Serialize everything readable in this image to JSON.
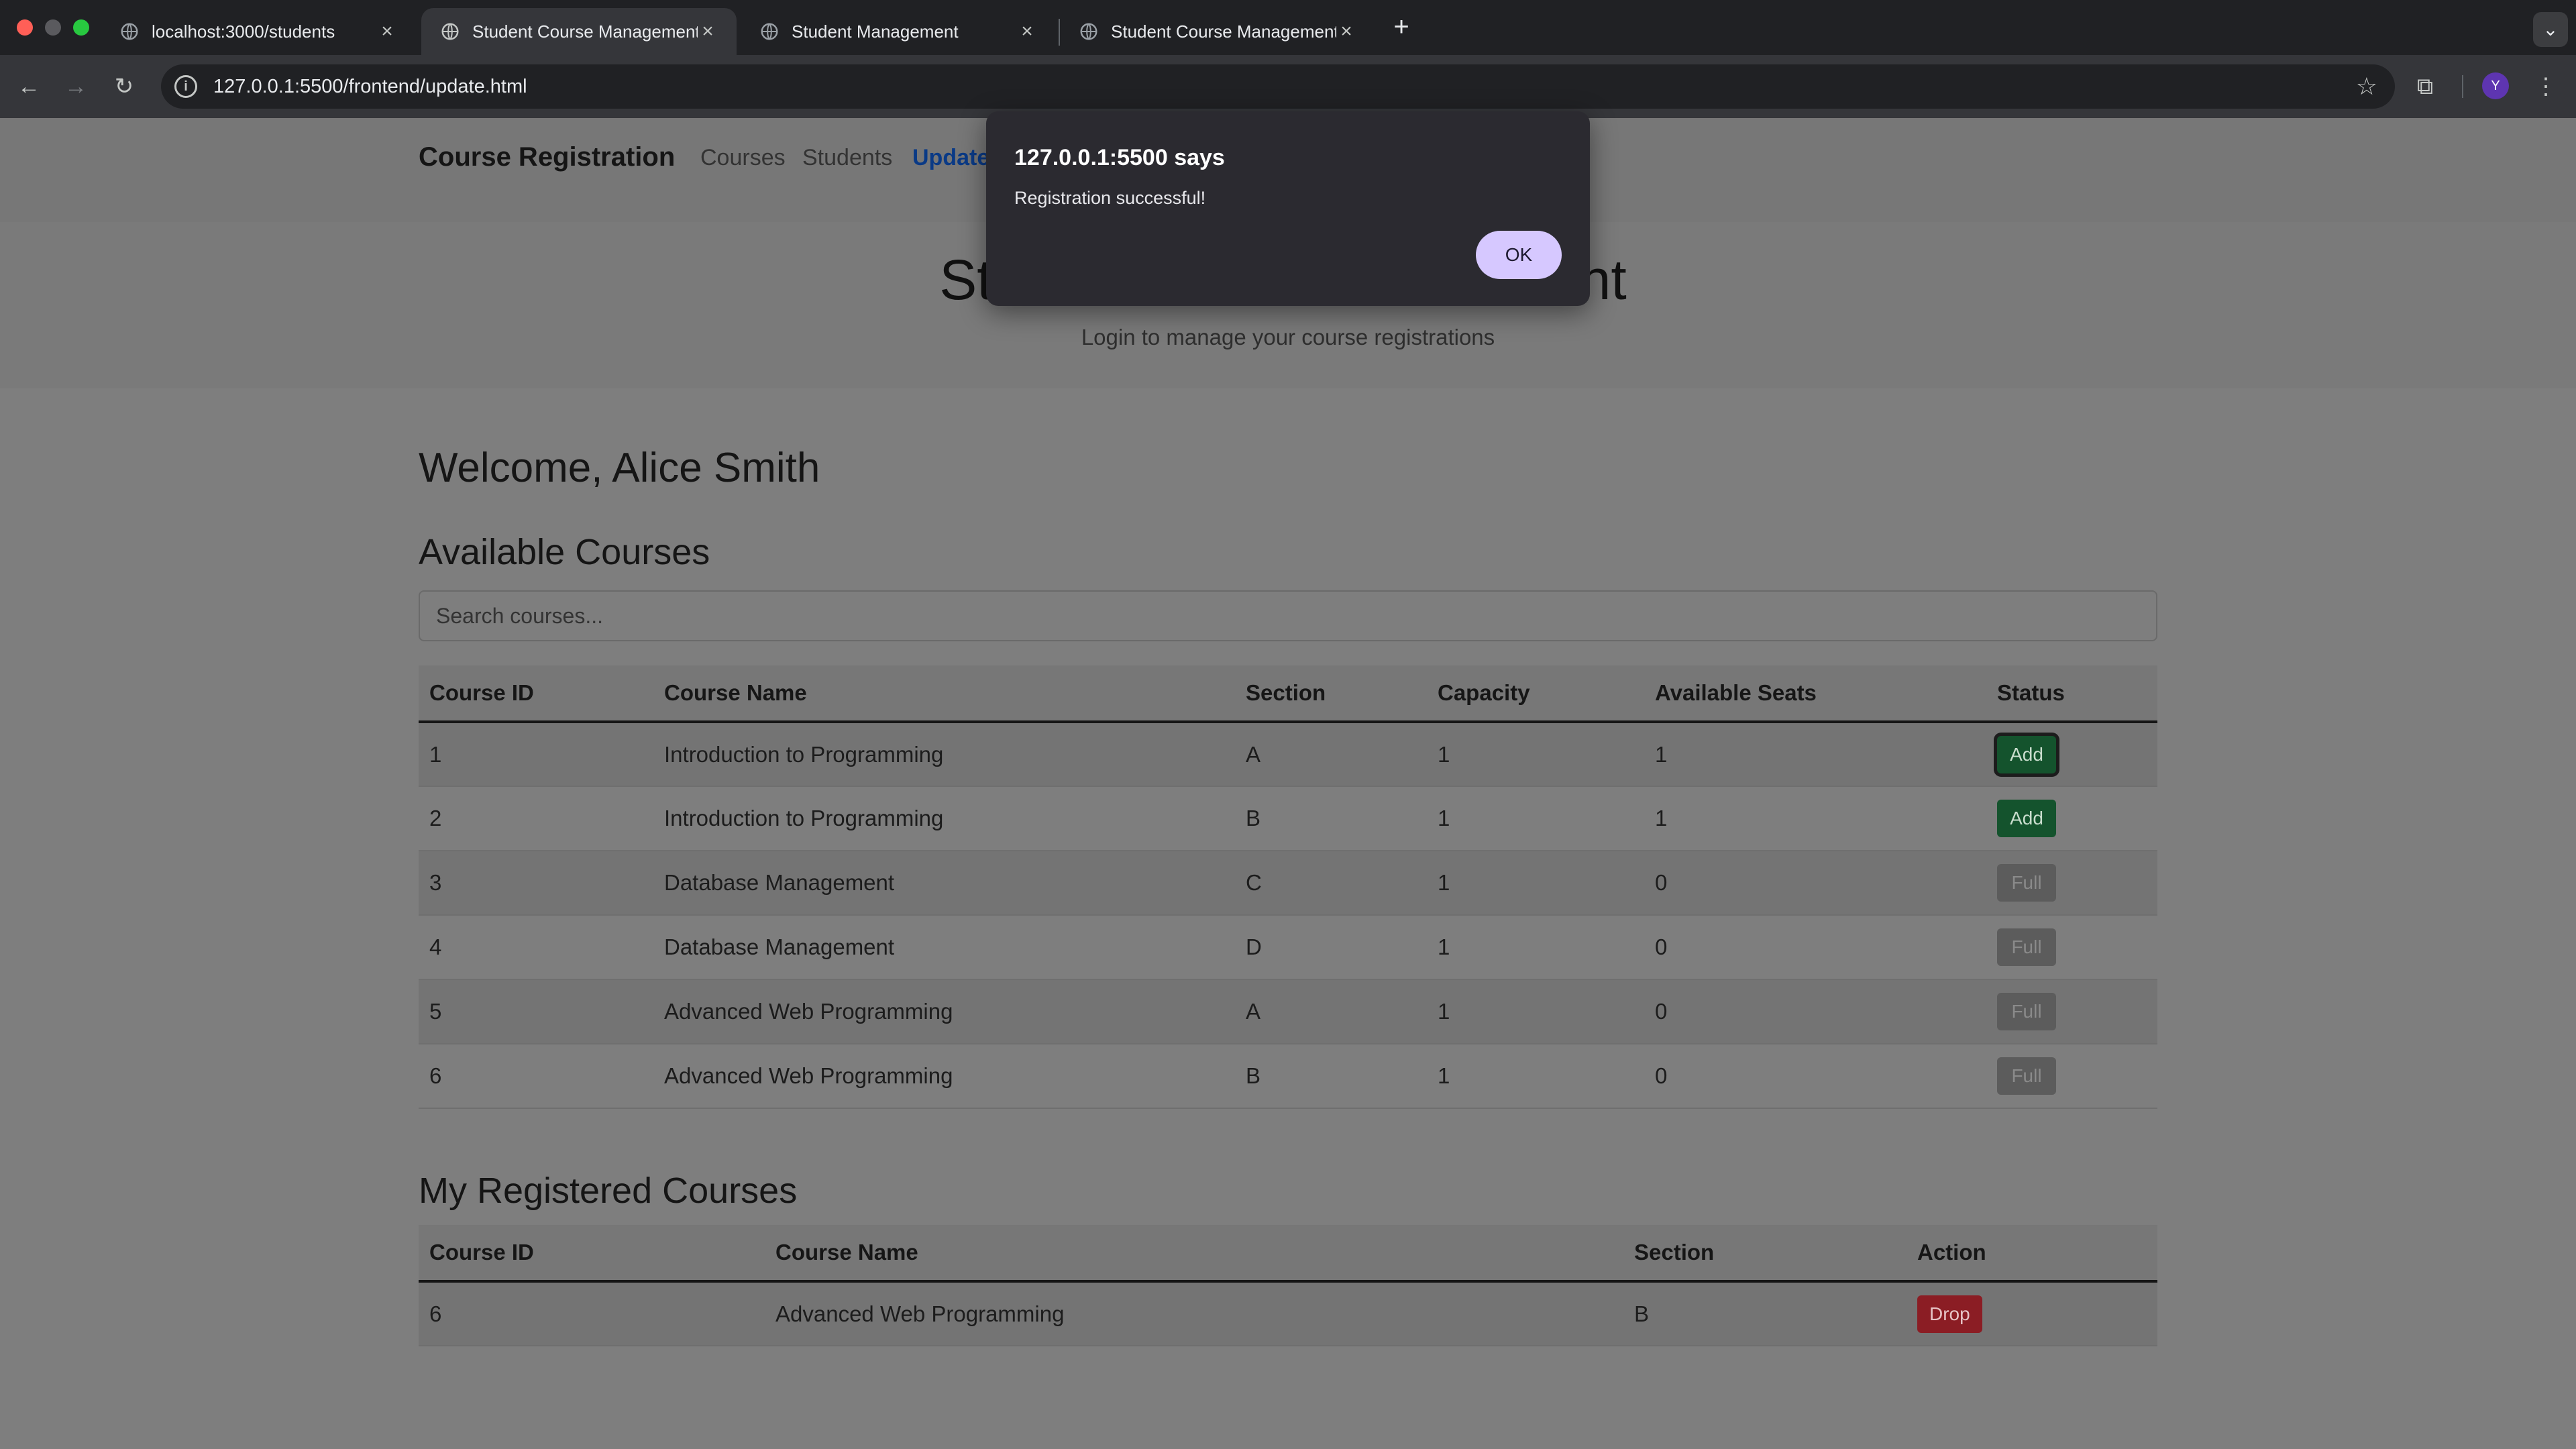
{
  "browser": {
    "tabs": [
      {
        "title": "localhost:3000/students",
        "active": false
      },
      {
        "title": "Student Course Management",
        "active": true
      },
      {
        "title": "Student Management",
        "active": false
      },
      {
        "title": "Student Course Management",
        "active": false
      }
    ],
    "url": "127.0.0.1:5500/frontend/update.html",
    "profile_initial": "Y"
  },
  "navbar": {
    "brand": "Course Registration",
    "links": [
      "Courses",
      "Students",
      "Update"
    ]
  },
  "hero": {
    "title_visible_left": "St",
    "title_visible_right": "nt",
    "subtitle": "Login to manage your course registrations"
  },
  "welcome": "Welcome, Alice Smith",
  "available": {
    "title": "Available Courses",
    "search_placeholder": "Search courses...",
    "headers": [
      "Course ID",
      "Course Name",
      "Section",
      "Capacity",
      "Available Seats",
      "Status"
    ],
    "rows": [
      {
        "id": "1",
        "name": "Introduction to Programming",
        "section": "A",
        "capacity": "1",
        "seats": "1",
        "status": "Add"
      },
      {
        "id": "2",
        "name": "Introduction to Programming",
        "section": "B",
        "capacity": "1",
        "seats": "1",
        "status": "Add"
      },
      {
        "id": "3",
        "name": "Database Management",
        "section": "C",
        "capacity": "1",
        "seats": "0",
        "status": "Full"
      },
      {
        "id": "4",
        "name": "Database Management",
        "section": "D",
        "capacity": "1",
        "seats": "0",
        "status": "Full"
      },
      {
        "id": "5",
        "name": "Advanced Web Programming",
        "section": "A",
        "capacity": "1",
        "seats": "0",
        "status": "Full"
      },
      {
        "id": "6",
        "name": "Advanced Web Programming",
        "section": "B",
        "capacity": "1",
        "seats": "0",
        "status": "Full"
      }
    ]
  },
  "registered": {
    "title": "My Registered Courses",
    "headers": [
      "Course ID",
      "Course Name",
      "Section",
      "Action"
    ],
    "rows": [
      {
        "id": "6",
        "name": "Advanced Web Programming",
        "section": "B",
        "action": "Drop"
      }
    ]
  },
  "dialog": {
    "title": "127.0.0.1:5500 says",
    "message": "Registration successful!",
    "ok_label": "OK"
  },
  "colors": {
    "add": "#14532d",
    "drop": "#8b1d24",
    "full": "#5c5c5c",
    "dialog_ok": "#d6c8ff"
  }
}
